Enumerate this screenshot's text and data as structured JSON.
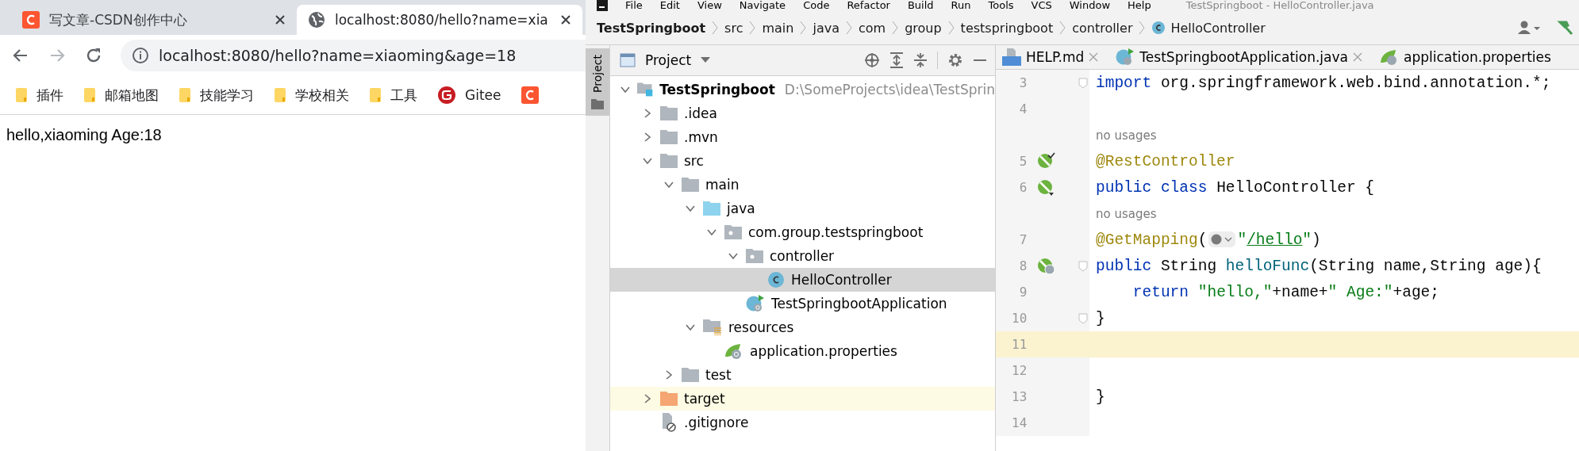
{
  "browser": {
    "tabs": [
      {
        "title": "写文章-CSDN创作中心",
        "kind": "csdn",
        "selected": false
      },
      {
        "title": "localhost:8080/hello?name=xia",
        "kind": "globe",
        "selected": true
      }
    ],
    "address": "localhost:8080/hello?name=xiaoming&age=18",
    "bookmarks": [
      {
        "label": "插件",
        "kind": "folder"
      },
      {
        "label": "邮箱地图",
        "kind": "folder"
      },
      {
        "label": "技能学习",
        "kind": "folder"
      },
      {
        "label": "学校相关",
        "kind": "folder"
      },
      {
        "label": "工具",
        "kind": "folder"
      },
      {
        "label": "Gitee",
        "kind": "gitee"
      },
      {
        "kind": "csdn"
      }
    ],
    "content": "hello,xiaoming Age:18"
  },
  "ide": {
    "menu": [
      "File",
      "Edit",
      "View",
      "Navigate",
      "Code",
      "Refactor",
      "Build",
      "Run",
      "Tools",
      "VCS",
      "Window",
      "Help"
    ],
    "title": "TestSpringboot - HelloController.java",
    "breadcrumbs": [
      {
        "label": "TestSpringboot",
        "kind": "root"
      },
      {
        "label": "src",
        "kind": "folder"
      },
      {
        "label": "main",
        "kind": "folder"
      },
      {
        "label": "java",
        "kind": "folder"
      },
      {
        "label": "com",
        "kind": "folder"
      },
      {
        "label": "group",
        "kind": "folder"
      },
      {
        "label": "testspringboot",
        "kind": "folder"
      },
      {
        "label": "controller",
        "kind": "folder"
      },
      {
        "label": "HelloController",
        "kind": "class"
      }
    ],
    "side_tab": "Project",
    "panel_title": "Project",
    "tree": [
      {
        "label": "TestSpringboot",
        "location": "D:\\SomeProjects\\idea\\TestSprin",
        "kind": "module",
        "expanded": true,
        "selected": false,
        "highlighted": false,
        "children": [
          {
            "label": ".idea",
            "kind": "folder",
            "expanded": false,
            "selected": false,
            "highlighted": false
          },
          {
            "label": ".mvn",
            "kind": "folder",
            "expanded": false,
            "selected": false,
            "highlighted": false
          },
          {
            "label": "src",
            "kind": "folder",
            "expanded": true,
            "selected": false,
            "highlighted": false,
            "children": [
              {
                "label": "main",
                "kind": "folder",
                "expanded": true,
                "selected": false,
                "highlighted": false,
                "children": [
                  {
                    "label": "java",
                    "kind": "source",
                    "expanded": true,
                    "selected": false,
                    "highlighted": false,
                    "children": [
                      {
                        "label": "com.group.testspringboot",
                        "kind": "package",
                        "expanded": true,
                        "selected": false,
                        "highlighted": false,
                        "children": [
                          {
                            "label": "controller",
                            "kind": "package",
                            "expanded": true,
                            "selected": false,
                            "highlighted": false,
                            "children": [
                              {
                                "label": "HelloController",
                                "kind": "class",
                                "selected": true,
                                "highlighted": false
                              }
                            ]
                          },
                          {
                            "label": "TestSpringbootApplication",
                            "kind": "spring-class",
                            "selected": false,
                            "highlighted": false
                          }
                        ]
                      }
                    ]
                  },
                  {
                    "label": "resources",
                    "kind": "resources",
                    "expanded": true,
                    "selected": false,
                    "highlighted": false,
                    "children": [
                      {
                        "label": "application.properties",
                        "kind": "properties",
                        "selected": false,
                        "highlighted": false
                      }
                    ]
                  }
                ]
              },
              {
                "label": "test",
                "kind": "folder",
                "expanded": false,
                "selected": false,
                "highlighted": false
              }
            ]
          },
          {
            "label": "target",
            "kind": "excluded",
            "expanded": false,
            "selected": false,
            "highlighted": true
          },
          {
            "label": ".gitignore",
            "kind": "ignore",
            "selected": false,
            "highlighted": false
          }
        ]
      }
    ],
    "editor_tabs": [
      {
        "label": "HELP.md",
        "kind": "md"
      },
      {
        "label": "TestSpringbootApplication.java",
        "kind": "spring-class"
      },
      {
        "label": "application.properties",
        "kind": "properties"
      }
    ],
    "lines": [
      {
        "kind": "code",
        "number": "3",
        "fold": true,
        "current": false,
        "tokens": [
          {
            "kind": "keyword",
            "s": "import"
          },
          {
            "kind": "plain",
            "s": " org.springframework.web.bind.annotation.*;"
          }
        ]
      },
      {
        "kind": "code",
        "number": "4",
        "fold": false,
        "current": false
      },
      {
        "kind": "inlay",
        "text": "no usages"
      },
      {
        "kind": "code",
        "number": "5",
        "gutter_icon": {
          "kind": "bean-check"
        },
        "fold": false,
        "current": false,
        "tokens": [
          {
            "kind": "annotation",
            "s": "@RestController"
          }
        ]
      },
      {
        "kind": "code",
        "number": "6",
        "gutter_icon": {
          "kind": "bean-down"
        },
        "fold": false,
        "current": false,
        "tokens": [
          {
            "kind": "keyword",
            "s": "public class "
          },
          {
            "kind": "plain",
            "s": "HelloController {"
          }
        ]
      },
      {
        "kind": "inlay",
        "text": "no usages"
      },
      {
        "kind": "code",
        "number": "7",
        "fold": false,
        "current": false,
        "tokens": [
          {
            "kind": "annotation",
            "s": "@GetMapping"
          },
          {
            "kind": "plain",
            "s": "("
          },
          {
            "kind": "web-icon"
          },
          {
            "kind": "string",
            "s": "\""
          },
          {
            "kind": "link",
            "s": "/hello"
          },
          {
            "kind": "string",
            "s": "\""
          },
          {
            "kind": "plain",
            "s": ")"
          }
        ]
      },
      {
        "kind": "code",
        "number": "8",
        "gutter_icon": {
          "kind": "bean-web"
        },
        "fold": true,
        "current": false,
        "tokens": [
          {
            "kind": "keyword",
            "s": "public "
          },
          {
            "kind": "plain",
            "s": "String "
          },
          {
            "kind": "method",
            "s": "helloFunc"
          },
          {
            "kind": "plain",
            "s": "(String name,String age){"
          }
        ]
      },
      {
        "kind": "code",
        "number": "9",
        "fold": false,
        "current": false,
        "tokens": [
          {
            "kind": "keyword",
            "s": "    return "
          },
          {
            "kind": "string",
            "s": "\"hello,\""
          },
          {
            "kind": "plain",
            "s": "+name+"
          },
          {
            "kind": "string",
            "s": "\" Age:\""
          },
          {
            "kind": "plain",
            "s": "+age;"
          }
        ]
      },
      {
        "kind": "code",
        "number": "10",
        "fold": true,
        "current": false,
        "tokens": [
          {
            "kind": "plain",
            "s": "}"
          }
        ]
      },
      {
        "kind": "code",
        "number": "11",
        "fold": false,
        "current": true
      },
      {
        "kind": "code",
        "number": "12",
        "fold": false,
        "current": false
      },
      {
        "kind": "code",
        "number": "13",
        "fold": false,
        "current": false,
        "tokens": [
          {
            "kind": "plain",
            "s": "}"
          }
        ]
      },
      {
        "kind": "code",
        "number": "14",
        "fold": false,
        "current": false
      }
    ]
  }
}
